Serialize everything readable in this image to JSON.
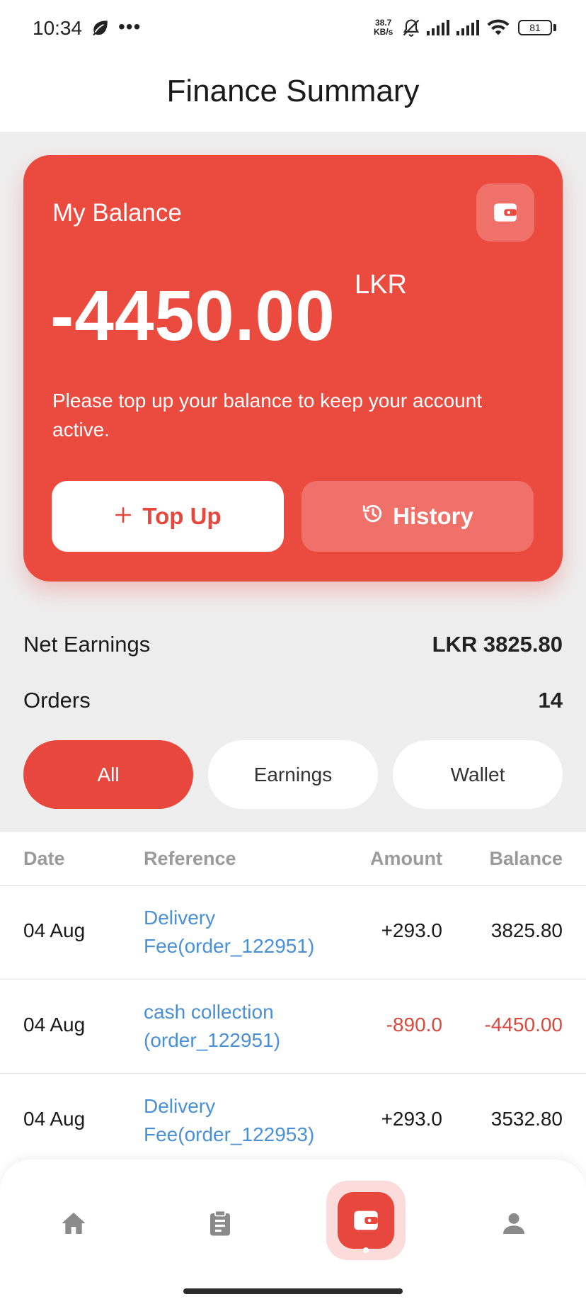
{
  "status_bar": {
    "time": "10:34",
    "net_speed_value": "38.7",
    "net_speed_unit": "KB/s",
    "battery_level": "81",
    "icons": [
      "leaf-icon",
      "more-dots-icon",
      "bell-muted-icon",
      "signal-icon",
      "signal-icon",
      "wifi-icon",
      "battery-icon"
    ]
  },
  "header": {
    "title": "Finance Summary"
  },
  "balance_card": {
    "title": "My Balance",
    "amount": "-4450.00",
    "currency": "LKR",
    "note": "Please top up your balance to keep your account active.",
    "topup_label": "Top Up",
    "history_label": "History",
    "icon": "wallet-icon"
  },
  "summary": {
    "net_earnings_label": "Net Earnings",
    "net_earnings_value": "LKR 3825.80",
    "orders_label": "Orders",
    "orders_value": "14"
  },
  "filters": {
    "items": [
      "All",
      "Earnings",
      "Wallet"
    ],
    "selected": "All"
  },
  "table": {
    "headers": {
      "date": "Date",
      "reference": "Reference",
      "amount": "Amount",
      "balance": "Balance"
    },
    "rows": [
      {
        "date": "04 Aug",
        "reference": "Delivery Fee(order_122951)",
        "amount": "+293.0",
        "balance": "3825.80"
      },
      {
        "date": "04 Aug",
        "reference": "cash collection (order_122951)",
        "amount": "-890.0",
        "balance": "-4450.00"
      },
      {
        "date": "04 Aug",
        "reference": "Delivery Fee(order_122953)",
        "amount": "+293.0",
        "balance": "3532.80"
      }
    ]
  },
  "bottom_nav": {
    "items": [
      "home-icon",
      "clipboard-icon",
      "wallet-icon",
      "person-icon"
    ],
    "active": "wallet-icon"
  },
  "colors": {
    "accent": "#e8473d",
    "card": "#eb4a3f",
    "link": "#4a90d9",
    "negative": "#d9493e",
    "background": "#eeeeee"
  }
}
